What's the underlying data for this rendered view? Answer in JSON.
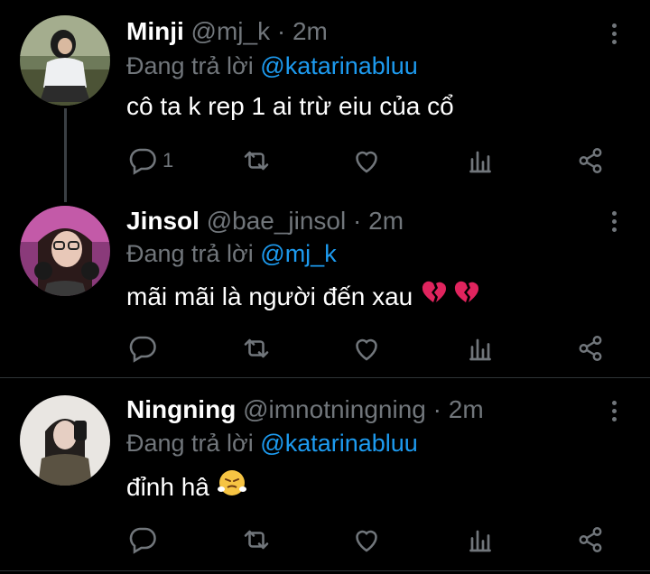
{
  "tweets": [
    {
      "name": "Minji",
      "handle": "@mj_k",
      "dot": "·",
      "time": "2m",
      "reply_prefix": "Đang trả lời",
      "reply_to": "@katarinabluu",
      "text": "cô ta k rep 1 ai trừ eiu của cổ",
      "reply_count": "1"
    },
    {
      "name": "Jinsol",
      "handle": "@bae_jinsol",
      "dot": "·",
      "time": "2m",
      "reply_prefix": "Đang trả lời",
      "reply_to": "@mj_k",
      "text": "mãi mãi là người đến xau",
      "emoji": "broken-heart-icon"
    },
    {
      "name": "Ningning",
      "handle": "@imnotningning",
      "dot": "·",
      "time": "2m",
      "reply_prefix": "Đang trả lời",
      "reply_to": "@katarinabluu",
      "text": "đỉnh hâ",
      "emoji": "steam-face-icon"
    }
  ],
  "colors": {
    "muted": "#71767b",
    "accent": "#1d9bf0",
    "heart": "#e0245e"
  }
}
